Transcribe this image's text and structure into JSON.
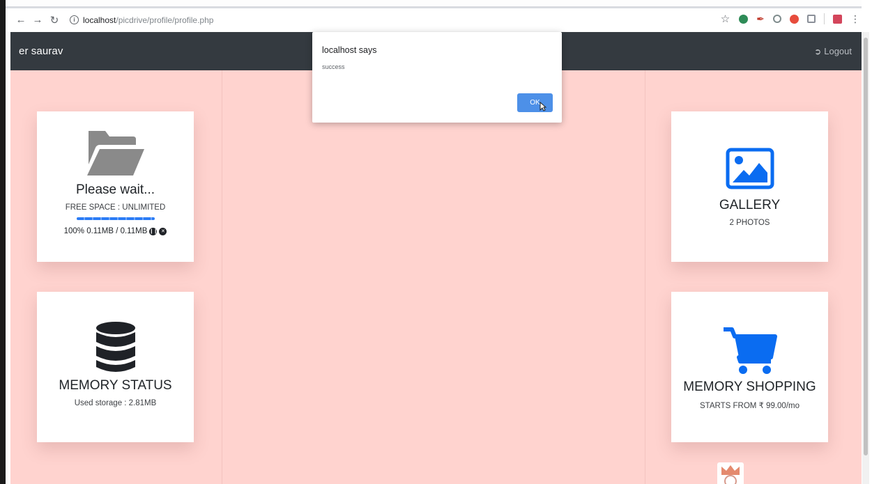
{
  "browser": {
    "url_host": "localhost",
    "url_path": "/picdrive/profile/profile.php"
  },
  "navbar": {
    "brand": "er saurav",
    "logout_label": "Logout"
  },
  "cards": {
    "upload": {
      "title": "Please wait...",
      "free_space": "FREE SPACE : UNLIMITED",
      "progress_percent": 100,
      "progress_text": "100% 0.11MB / 0.11MB",
      "icon": "folder-open-icon"
    },
    "memory_status": {
      "title": "MEMORY STATUS",
      "subtitle": "Used storage : 2.81MB",
      "icon": "database-icon"
    },
    "gallery": {
      "title": "GALLERY",
      "subtitle": "2 PHOTOS",
      "icon": "image-icon"
    },
    "memory_shopping": {
      "title": "MEMORY SHOPPING",
      "subtitle": "STARTS FROM ₹ 99.00/mo",
      "icon": "shopping-cart-icon"
    }
  },
  "dialog": {
    "title": "localhost says",
    "message": "success",
    "ok_label": "OK"
  },
  "colors": {
    "navbar_bg": "#343a40",
    "content_bg": "#ffd3cf",
    "accent_blue": "#0a6cf1",
    "icon_gray": "#8a8a8a",
    "icon_dark": "#1f2227",
    "ok_button": "#4d90e8"
  }
}
